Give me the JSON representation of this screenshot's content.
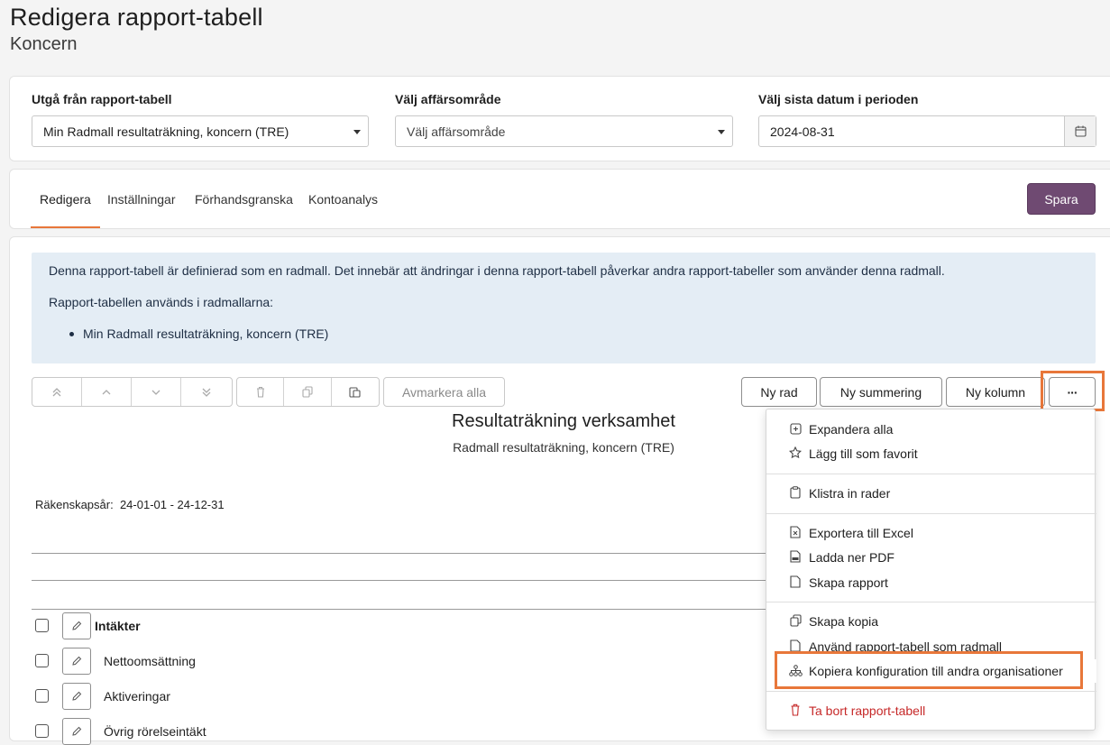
{
  "header": {
    "title": "Redigera rapport-tabell",
    "subtitle": "Koncern"
  },
  "filters": {
    "base_label": "Utgå från rapport-tabell",
    "base_value": "Min Radmall resultaträkning, koncern (TRE)",
    "area_label": "Välj affärsområde",
    "area_placeholder": "Välj affärsområde",
    "date_label": "Välj sista datum i perioden",
    "date_value": "2024-08-31"
  },
  "tabs": [
    {
      "label": "Redigera",
      "active": true
    },
    {
      "label": "Inställningar",
      "active": false
    },
    {
      "label": "Förhandsgranska",
      "active": false
    },
    {
      "label": "Kontoanalys",
      "active": false
    }
  ],
  "save_label": "Spara",
  "info": {
    "line1": "Denna rapport-tabell är definierad som en radmall. Det innebär att ändringar i denna rapport-tabell påverkar andra rapport-tabeller som använder denna radmall.",
    "line2": "Rapport-tabellen används i radmallarna:",
    "items": [
      "Min Radmall resultaträkning, koncern (TRE)"
    ]
  },
  "toolbar": {
    "deselect_all": "Avmarkera alla",
    "new_row": "Ny rad",
    "new_sum": "Ny summering",
    "new_column": "Ny kolumn",
    "more": "···"
  },
  "report": {
    "title": "Resultaträkning verksamhet",
    "subtitle": "Radmall resultaträkning, koncern (TRE)",
    "fiscal_year_label": "Räkenskapsår:",
    "fiscal_year_value": "24-01-01 - 24-12-31",
    "rows": [
      {
        "label": "Intäkter",
        "bold": true
      },
      {
        "label": "Nettoomsättning",
        "bold": false
      },
      {
        "label": "Aktiveringar",
        "bold": false
      },
      {
        "label": "Övrig rörelseintäkt",
        "bold": false
      }
    ]
  },
  "menu": {
    "items": [
      {
        "label": "Expandera alla",
        "icon": "plus-square-icon"
      },
      {
        "label": "Lägg till som favorit",
        "icon": "star-icon"
      },
      {
        "label": "Klistra in rader",
        "icon": "clipboard-icon"
      },
      {
        "label": "Exportera till Excel",
        "icon": "excel-file-icon"
      },
      {
        "label": "Ladda ner PDF",
        "icon": "pdf-file-icon"
      },
      {
        "label": "Skapa rapport",
        "icon": "file-icon"
      },
      {
        "label": "Skapa kopia",
        "icon": "copy-icon"
      },
      {
        "label": "Använd rapport-tabell som radmall",
        "icon": "file-icon"
      },
      {
        "label": "Kopiera konfiguration till andra organisationer",
        "icon": "org-chart-icon"
      },
      {
        "label": "Ta bort rapport-tabell",
        "icon": "trash-icon",
        "danger": true
      }
    ]
  },
  "colors": {
    "accent": "#e8773a",
    "primary": "#6f4a72",
    "info_bg": "#e4edf5",
    "danger": "#c62828"
  }
}
